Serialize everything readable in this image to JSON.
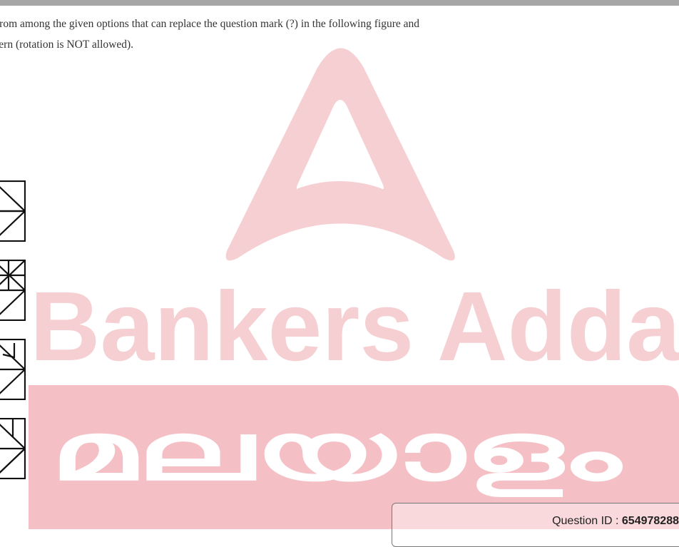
{
  "question": {
    "line1": "from among the given options that can replace the question mark (?) in the following figure and",
    "line2": "tern (rotation is NOT allowed)."
  },
  "options": [
    {
      "id": "option-1"
    },
    {
      "id": "option-2"
    },
    {
      "id": "option-3"
    },
    {
      "id": "option-4"
    }
  ],
  "footer": {
    "qid_label": "Question ID : ",
    "qid_value": "654978288"
  },
  "watermark": {
    "brand_line1": "Bankers Adda",
    "brand_line2": "മലയാളം",
    "color": "#f4c9cd"
  },
  "colors": {
    "top_bar": "#a6a6a6",
    "text": "#333333",
    "figure_stroke": "#111111"
  }
}
